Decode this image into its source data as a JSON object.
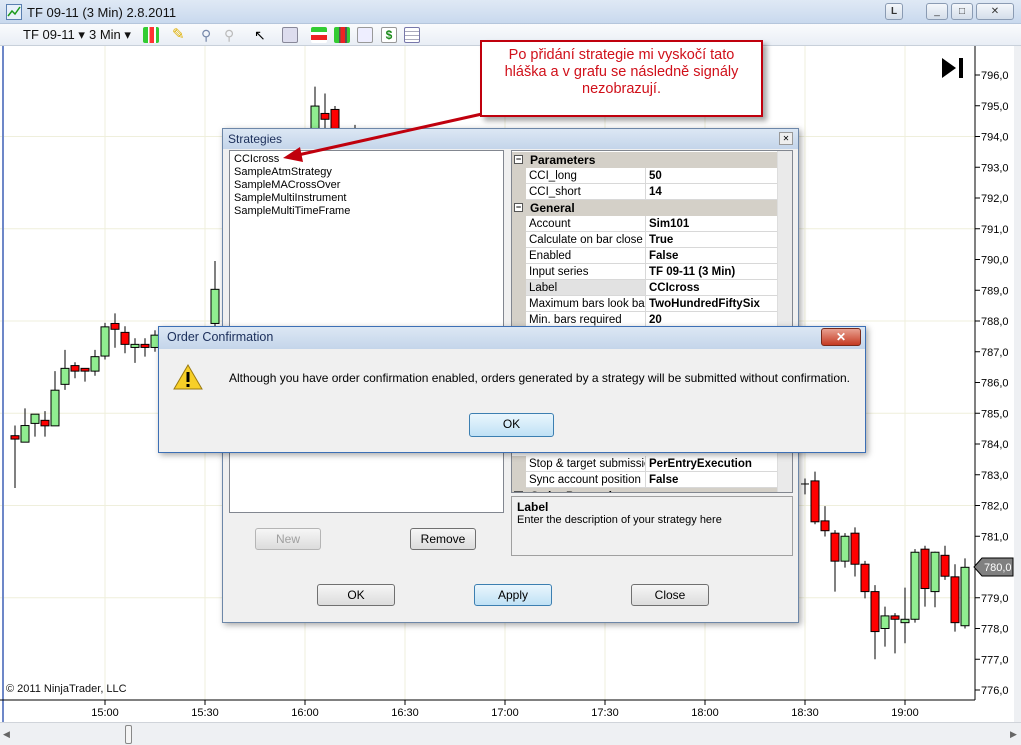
{
  "window": {
    "title": "TF 09-11 (3 Min)  2.8.2011",
    "minimize": "_",
    "restore": "□",
    "close": "✕",
    "l_button": "L"
  },
  "toolbar": {
    "instrument": "TF 09-11",
    "interval": "3 Min",
    "icons": [
      "candlestick-icon",
      "pencil-icon",
      "zoom-in-icon",
      "zoom-out-icon",
      "cursor-icon",
      "magnifier-icon",
      "strategies-icon",
      "bars-icon",
      "indicators-icon",
      "dollar-icon",
      "data-box-icon"
    ]
  },
  "chart": {
    "copyright": "© 2011 NinjaTrader, LLC",
    "last_price_label": "780,0",
    "colors": {
      "up": "#90ee90",
      "down": "#ff0000",
      "grid": "#efefdc"
    }
  },
  "chart_data": {
    "type": "candlestick",
    "ylim": [
      776,
      796
    ],
    "yticks": [
      "776,0",
      "777,0",
      "778,0",
      "779,0",
      "780,0",
      "781,0",
      "782,0",
      "783,0",
      "784,0",
      "785,0",
      "786,0",
      "787,0",
      "788,0",
      "789,0",
      "790,0",
      "791,0",
      "792,0",
      "793,0",
      "794,0",
      "795,0",
      "796,0"
    ],
    "xticks": [
      "15:00",
      "15:30",
      "16:00",
      "16:30",
      "17:00",
      "17:30",
      "18:00",
      "18:30",
      "19:00"
    ],
    "last_price": 780.0,
    "bars": [
      {
        "t": "14:33",
        "o": 784.27,
        "h": 784.6,
        "l": 782.57,
        "c": 784.16
      },
      {
        "t": "14:36",
        "o": 784.06,
        "h": 785.16,
        "l": 784.06,
        "c": 784.6
      },
      {
        "t": "14:39",
        "o": 784.67,
        "h": 784.97,
        "l": 784.24,
        "c": 784.97
      },
      {
        "t": "14:42",
        "o": 784.77,
        "h": 785.07,
        "l": 784.24,
        "c": 784.59
      },
      {
        "t": "14:45",
        "o": 784.59,
        "h": 786.37,
        "l": 784.59,
        "c": 785.75
      },
      {
        "t": "14:48",
        "o": 785.94,
        "h": 787.06,
        "l": 785.76,
        "c": 786.46
      },
      {
        "t": "14:51",
        "o": 786.55,
        "h": 786.66,
        "l": 786.14,
        "c": 786.37
      },
      {
        "t": "14:54",
        "o": 786.46,
        "h": 786.46,
        "l": 786.03,
        "c": 786.37
      },
      {
        "t": "14:57",
        "o": 786.37,
        "h": 787.06,
        "l": 786.22,
        "c": 786.84
      },
      {
        "t": "15:00",
        "o": 786.86,
        "h": 787.94,
        "l": 786.75,
        "c": 787.81
      },
      {
        "t": "15:03",
        "o": 787.92,
        "h": 788.25,
        "l": 787.13,
        "c": 787.73
      },
      {
        "t": "15:06",
        "o": 787.63,
        "h": 787.83,
        "l": 786.95,
        "c": 787.24
      },
      {
        "t": "15:09",
        "o": 787.14,
        "h": 787.44,
        "l": 786.64,
        "c": 787.24
      },
      {
        "t": "15:12",
        "o": 787.24,
        "h": 787.44,
        "l": 786.84,
        "c": 787.14
      },
      {
        "t": "15:15",
        "o": 787.14,
        "h": 787.7,
        "l": 787.0,
        "c": 787.54
      },
      {
        "t": "15:33",
        "o": 787.92,
        "h": 789.95,
        "l": 787.6,
        "c": 789.03
      },
      {
        "t": "16:03",
        "o": 793.3,
        "h": 795.62,
        "l": 793.0,
        "c": 794.99
      },
      {
        "t": "16:06",
        "o": 794.75,
        "h": 795.4,
        "l": 793.5,
        "c": 794.56
      },
      {
        "t": "16:09",
        "o": 794.88,
        "h": 794.99,
        "l": 793.0,
        "c": 793.5
      },
      {
        "t": "16:15",
        "o": 793.5,
        "h": 794.38,
        "l": 793.0,
        "c": 793.3
      },
      {
        "t": "18:30",
        "o": 782.7,
        "h": 782.88,
        "l": 782.36,
        "c": 782.7
      },
      {
        "t": "18:33",
        "o": 782.8,
        "h": 783.1,
        "l": 781.39,
        "c": 781.47
      },
      {
        "t": "18:36",
        "o": 781.5,
        "h": 781.98,
        "l": 780.99,
        "c": 781.18
      },
      {
        "t": "18:39",
        "o": 781.1,
        "h": 781.2,
        "l": 779.2,
        "c": 780.19
      },
      {
        "t": "18:42",
        "o": 780.19,
        "h": 781.1,
        "l": 779.98,
        "c": 781.0
      },
      {
        "t": "18:45",
        "o": 781.1,
        "h": 781.29,
        "l": 779.69,
        "c": 780.09
      },
      {
        "t": "18:48",
        "o": 780.09,
        "h": 780.2,
        "l": 778.98,
        "c": 779.2
      },
      {
        "t": "18:51",
        "o": 779.2,
        "h": 779.41,
        "l": 777.0,
        "c": 777.9
      },
      {
        "t": "18:54",
        "o": 778.0,
        "h": 778.71,
        "l": 777.41,
        "c": 778.41
      },
      {
        "t": "18:57",
        "o": 778.41,
        "h": 778.5,
        "l": 777.19,
        "c": 778.3
      },
      {
        "t": "19:00",
        "o": 778.19,
        "h": 779.33,
        "l": 777.52,
        "c": 778.3
      },
      {
        "t": "19:03",
        "o": 778.3,
        "h": 780.58,
        "l": 778.19,
        "c": 780.48
      },
      {
        "t": "19:06",
        "o": 780.58,
        "h": 780.69,
        "l": 778.71,
        "c": 779.3
      },
      {
        "t": "19:09",
        "o": 779.2,
        "h": 780.5,
        "l": 778.69,
        "c": 780.48
      },
      {
        "t": "19:12",
        "o": 780.38,
        "h": 780.69,
        "l": 779.58,
        "c": 779.7
      },
      {
        "t": "19:15",
        "o": 779.68,
        "h": 780.09,
        "l": 777.9,
        "c": 778.19
      },
      {
        "t": "19:18",
        "o": 778.09,
        "h": 780.28,
        "l": 778.0,
        "c": 779.99
      }
    ]
  },
  "callout": {
    "text": "Po přidání strategie mi vyskočí tato hláška a v grafu se následně signály nezobrazují."
  },
  "strategies_dialog": {
    "title": "Strategies",
    "close": "✕",
    "strategies": [
      "CCIcross",
      "SampleAtmStrategy",
      "SampleMACrossOver",
      "SampleMultiInstrument",
      "SampleMultiTimeFrame"
    ],
    "properties_top": [
      {
        "cat": "Parameters"
      },
      {
        "k": "CCI_long",
        "v": "50"
      },
      {
        "k": "CCI_short",
        "v": "14"
      },
      {
        "cat": "General"
      },
      {
        "k": "Account",
        "v": "Sim101"
      },
      {
        "k": "Calculate on bar close",
        "v": "True"
      },
      {
        "k": "Enabled",
        "v": "False"
      },
      {
        "k": "Input series",
        "v": "TF 09-11 (3 Min)"
      },
      {
        "k": "Label",
        "v": "CCIcross"
      },
      {
        "k": "Maximum bars look back",
        "v": "TwoHundredFiftySix"
      },
      {
        "k": "Min. bars required",
        "v": "20"
      }
    ],
    "properties_bottom": [
      {
        "k": "Stop & target submission",
        "v": "PerEntryExecution"
      },
      {
        "k": "Sync account position",
        "v": "False"
      },
      {
        "cat": "Order Properties"
      }
    ],
    "description": {
      "title": "Label",
      "text": "Enter the description of your strategy here"
    },
    "buttons": {
      "new": "New",
      "remove": "Remove",
      "ok": "OK",
      "apply": "Apply",
      "close": "Close"
    }
  },
  "order_confirmation": {
    "title": "Order Confirmation",
    "close": "✕",
    "message": "Although you have order confirmation enabled, orders generated by a strategy will be submitted without confirmation.",
    "ok": "OK"
  }
}
